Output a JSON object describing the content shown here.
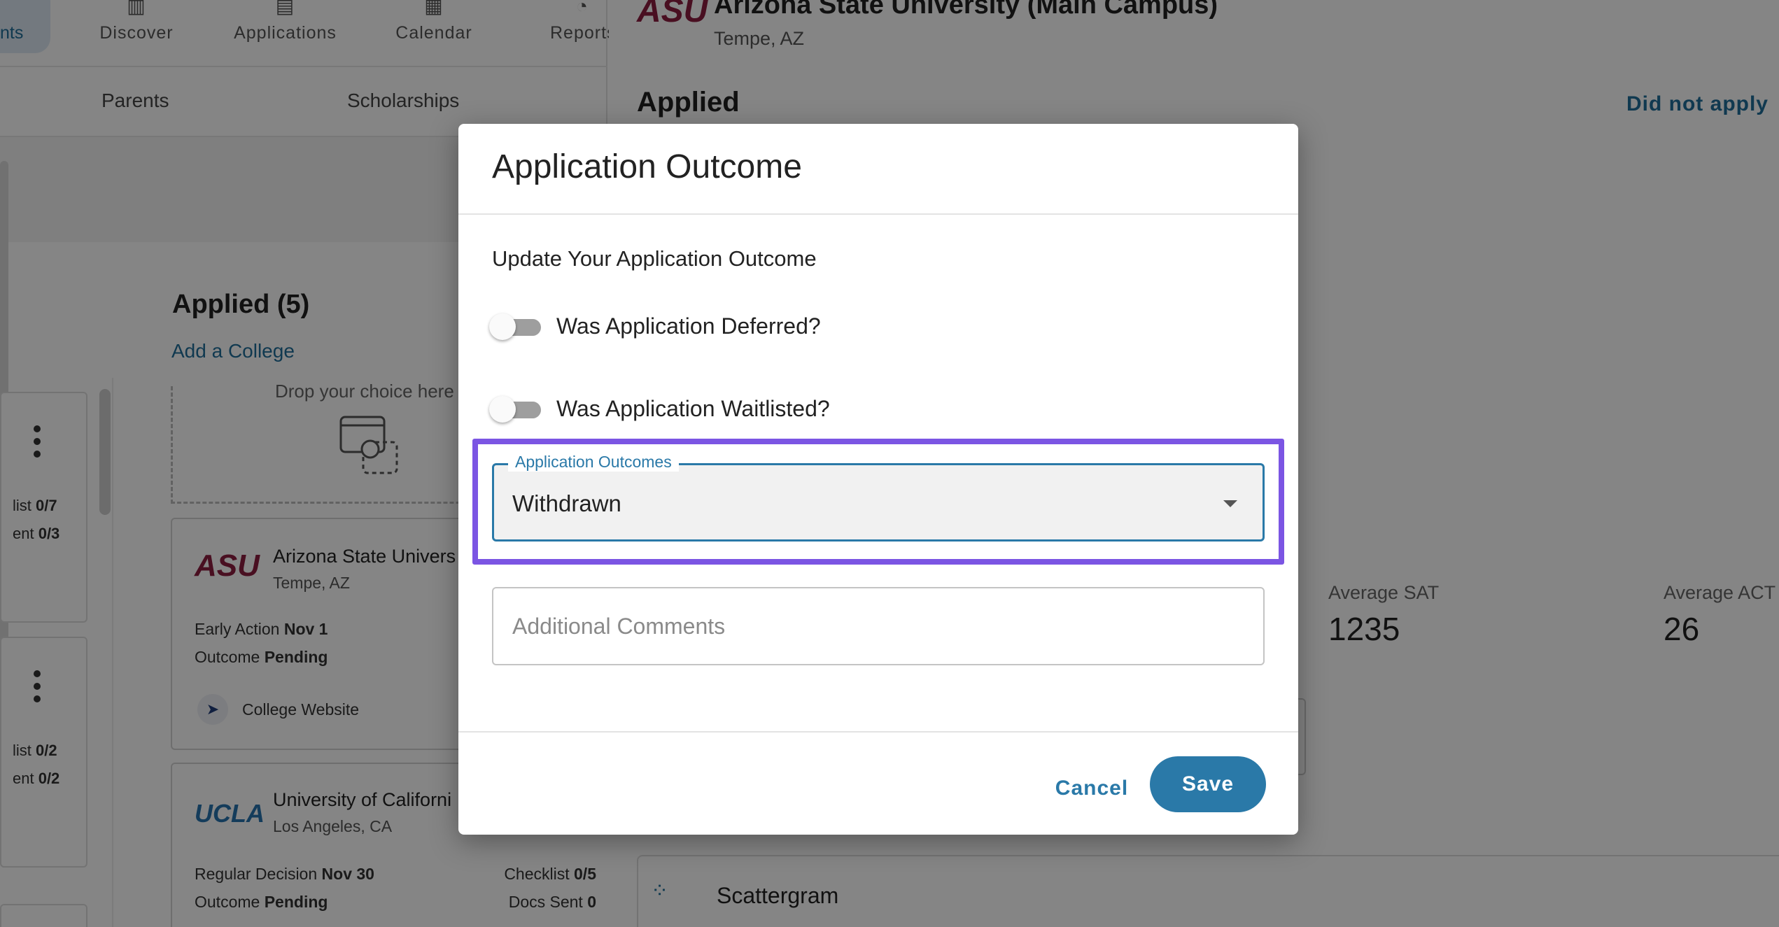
{
  "nav": {
    "active_label": "nts",
    "items": [
      {
        "label": "Discover"
      },
      {
        "label": "Applications"
      },
      {
        "label": "Calendar"
      },
      {
        "label": "Reports"
      }
    ]
  },
  "subnav": {
    "items": [
      {
        "label": "Parents"
      },
      {
        "label": "Scholarships"
      }
    ]
  },
  "mini_cards": [
    {
      "line1_prefix": "list ",
      "line1_value": "0/7",
      "line2_prefix": "ent ",
      "line2_value": "0/3"
    },
    {
      "line1_prefix": "list ",
      "line1_value": "0/2",
      "line2_prefix": "ent ",
      "line2_value": "0/2"
    }
  ],
  "applied_column": {
    "heading": "Applied (5)",
    "add_link": "Add a College",
    "drop_text": "Drop your choice here"
  },
  "college_cards": [
    {
      "logo": "ASU",
      "name": "Arizona State Univers",
      "location": "Tempe, AZ",
      "deadline_label": "Early Action ",
      "deadline_value": "Nov 1",
      "outcome_label": "Outcome ",
      "outcome_value": "Pending",
      "website_label": "College Website"
    },
    {
      "logo": "UCLA",
      "name": "University of Californi",
      "location": "Los Angeles, CA",
      "deadline_label": "Regular Decision ",
      "deadline_value": "Nov 30",
      "outcome_label": "Outcome ",
      "outcome_value": "Pending",
      "checklist_label": "Checklist ",
      "checklist_value": "0/5",
      "docs_label": "Docs Sent ",
      "docs_value": "0"
    }
  ],
  "detail": {
    "logo": "ASU",
    "title": "Arizona State University (Main Campus)",
    "location": "Tempe, AZ",
    "status": "Applied",
    "did_not_apply": "Did not apply",
    "stats": [
      {
        "label": "Average SAT",
        "value": "1235"
      },
      {
        "label": "Average ACT",
        "value": "26"
      }
    ],
    "scattergram": "Scattergram"
  },
  "dialog": {
    "title": "Application Outcome",
    "subtitle": "Update Your Application Outcome",
    "deferred_label": "Was Application Deferred?",
    "waitlisted_label": "Was Application Waitlisted?",
    "outcomes_label": "Application Outcomes",
    "outcomes_value": "Withdrawn",
    "comments_placeholder": "Additional Comments",
    "cancel_label": "Cancel",
    "save_label": "Save"
  },
  "colors": {
    "primary": "#2a79a8",
    "highlight": "#7b55e3",
    "asu_maroon": "#8c1d40",
    "ucla_blue": "#2774ae"
  }
}
